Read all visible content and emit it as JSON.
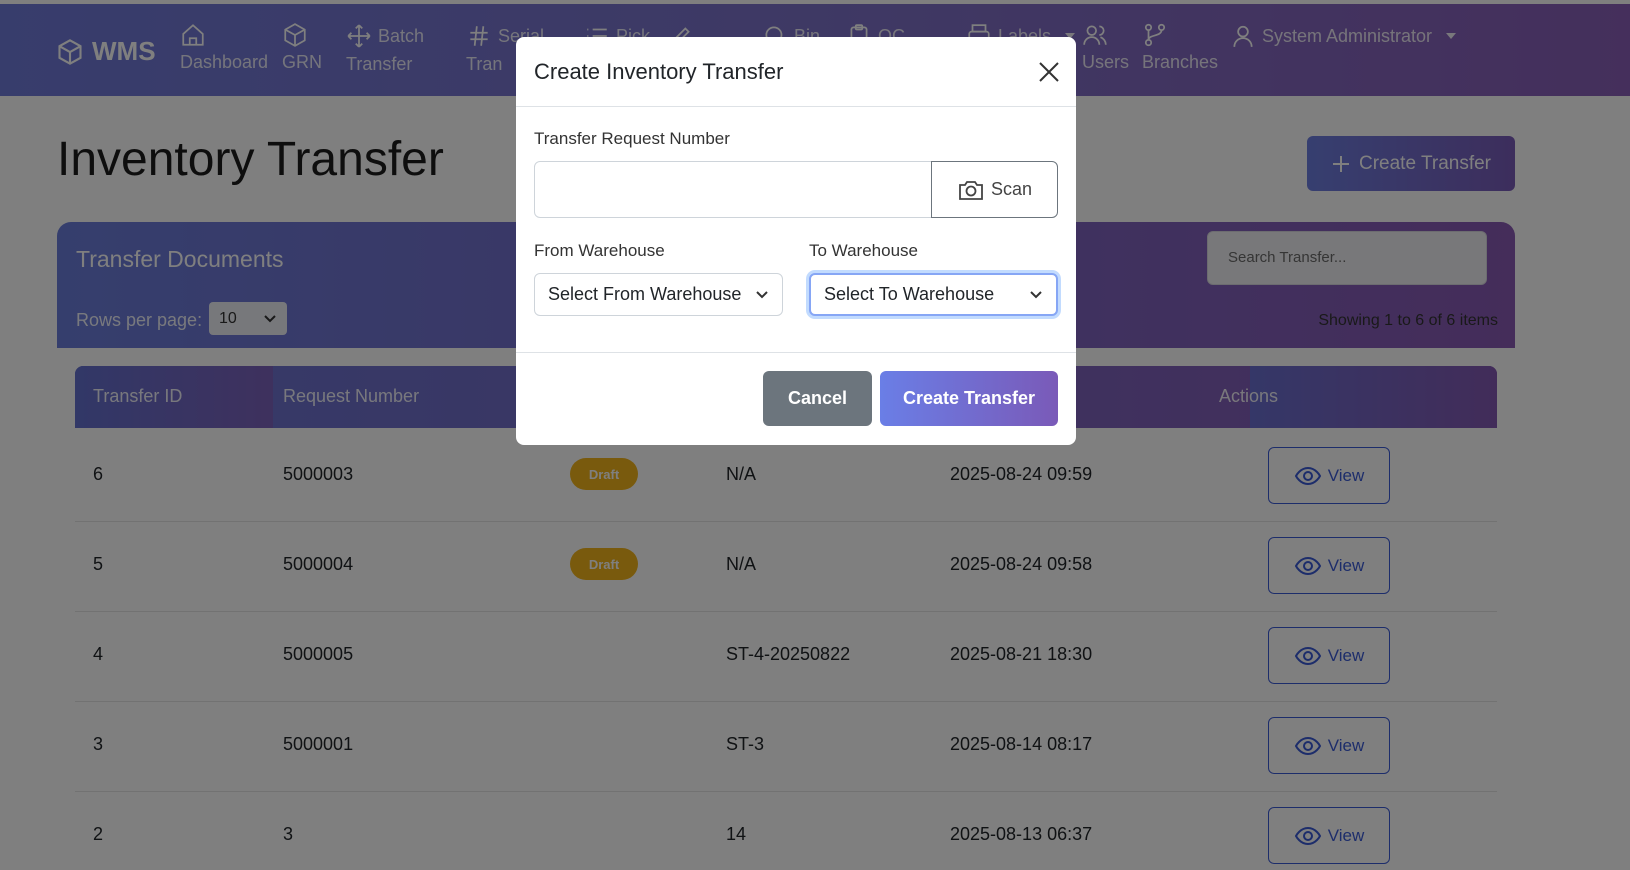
{
  "nav": {
    "brand": "WMS",
    "items": [
      {
        "icon": "home-icon",
        "line1": "",
        "line2": "Dashboard"
      },
      {
        "icon": "box-icon",
        "line1": "",
        "line2": "GRN"
      },
      {
        "icon": "move-icon",
        "line1": "Batch",
        "line2": "Transfer"
      },
      {
        "icon": "hash-icon",
        "line1": "Serial",
        "line2": "Tran"
      },
      {
        "icon": "list-icon",
        "line1": "Pick",
        "line2": ""
      },
      {
        "icon": "edit-icon",
        "line1": "",
        "line2": ""
      },
      {
        "icon": "search-icon",
        "line1": "Bin",
        "line2": ""
      },
      {
        "icon": "clipboard-icon",
        "line1": "QC",
        "line2": ""
      },
      {
        "icon": "printer-icon",
        "line1": "Labels",
        "line2": ""
      },
      {
        "icon": "users-icon",
        "line1": "",
        "line2": "Users"
      },
      {
        "icon": "branch-icon",
        "line1": "",
        "line2": "Branches"
      }
    ],
    "user": "System Administrator"
  },
  "page": {
    "title": "Inventory Transfer",
    "create_button": "Create Transfer"
  },
  "card": {
    "title": "Transfer Documents",
    "rows_label": "Rows per page:",
    "rows_value": "10",
    "search_placeholder": "Search Transfer...",
    "showing": "Showing 1 to 6 of 6 items"
  },
  "table": {
    "headers": [
      "Transfer ID",
      "Request Number",
      "",
      "",
      "",
      "Actions"
    ],
    "rows": [
      {
        "id": "6",
        "request": "5000003",
        "status": "Draft",
        "ref": "N/A",
        "date": "2025-08-24 09:59",
        "action": "View"
      },
      {
        "id": "5",
        "request": "5000004",
        "status": "Draft",
        "ref": "N/A",
        "date": "2025-08-24 09:58",
        "action": "View"
      },
      {
        "id": "4",
        "request": "5000005",
        "status": "",
        "ref": "ST-4-20250822",
        "date": "2025-08-21 18:30",
        "action": "View"
      },
      {
        "id": "3",
        "request": "5000001",
        "status": "",
        "ref": "ST-3",
        "date": "2025-08-14 08:17",
        "action": "View"
      },
      {
        "id": "2",
        "request": "3",
        "status": "",
        "ref": "14",
        "date": "2025-08-13 06:37",
        "action": "View"
      }
    ]
  },
  "modal": {
    "title": "Create Inventory Transfer",
    "request_label": "Transfer Request Number",
    "request_value": "",
    "scan_label": "Scan",
    "from_label": "From Warehouse",
    "from_value": "Select From Warehouse",
    "to_label": "To Warehouse",
    "to_value": "Select To Warehouse",
    "cancel": "Cancel",
    "submit": "Create Transfer"
  },
  "colors": {
    "accent": "#6f7ad9",
    "accent2": "#8a5fb8",
    "badge_draft": "#f2b51b",
    "link_blue": "#3b5bd6"
  }
}
